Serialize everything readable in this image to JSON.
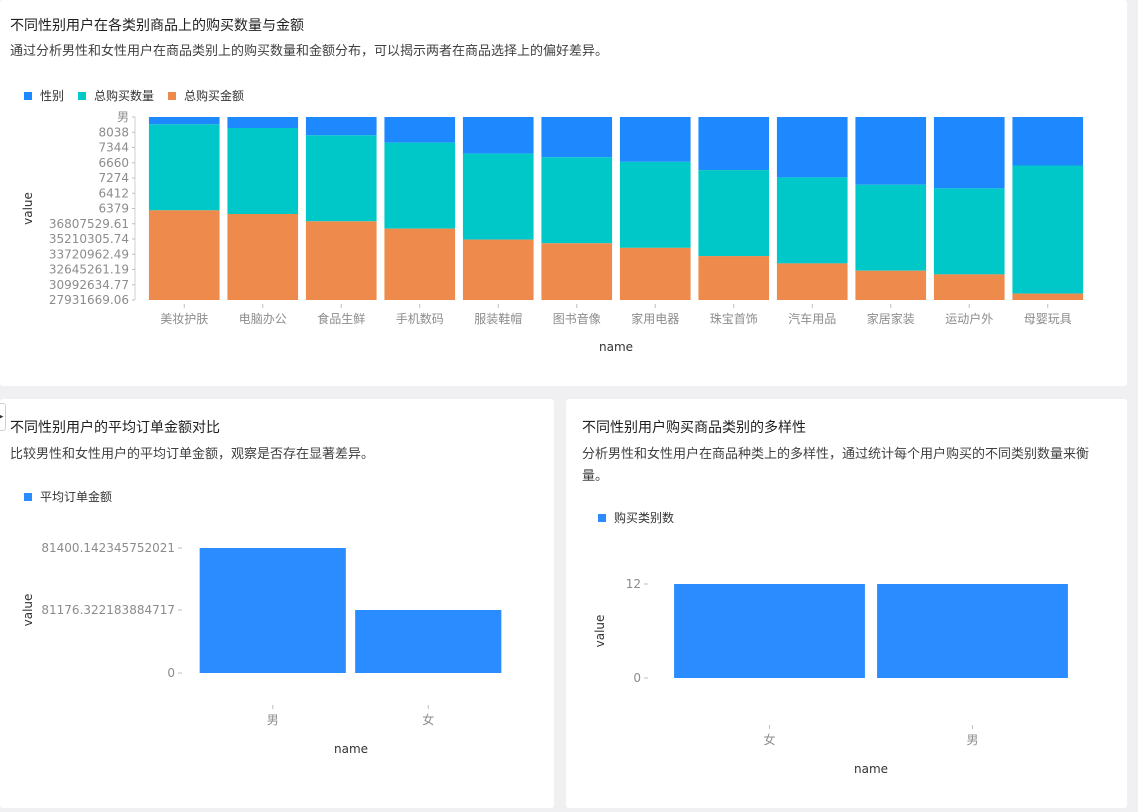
{
  "charts": [
    {
      "title": "不同性别用户在各类别商品上的购买数量与金额",
      "description": "通过分析男性和女性用户在商品类别上的购买数量和金额分布，可以揭示两者在商品选择上的偏好差异。"
    },
    {
      "title": "不同性别用户的平均订单金额对比",
      "description": "比较男性和女性用户的平均订单金额，观察是否存在显著差异。"
    },
    {
      "title": "不同性别用户购买商品类别的多样性",
      "description": "分析男性和女性用户在商品种类上的多样性，通过统计每个用户购买的不同类别数量来衡量。"
    }
  ],
  "chart_data": [
    {
      "type": "bar",
      "stacked": true,
      "percent_stacked": true,
      "xlabel": "name",
      "ylabel": "value",
      "categories": [
        "美妆护肤",
        "电脑办公",
        "食品生鲜",
        "手机数码",
        "服装鞋帽",
        "图书音像",
        "家用电器",
        "珠宝首饰",
        "汽车用品",
        "家居家装",
        "运动户外",
        "母婴玩具"
      ],
      "series": [
        {
          "name": "性别",
          "color": "#1e88ff",
          "values": [
            0.04,
            0.06,
            0.1,
            0.14,
            0.2,
            0.22,
            0.245,
            0.29,
            0.33,
            0.37,
            0.39,
            0.265
          ]
        },
        {
          "name": "总购买数量",
          "color": "#00c8c8",
          "values": [
            0.47,
            0.47,
            0.47,
            0.47,
            0.47,
            0.47,
            0.47,
            0.47,
            0.47,
            0.47,
            0.47,
            0.7
          ]
        },
        {
          "name": "总购买金额",
          "color": "#ee8a4c",
          "values": [
            0.49,
            0.47,
            0.43,
            0.39,
            0.33,
            0.31,
            0.285,
            0.24,
            0.2,
            0.16,
            0.14,
            0.035
          ]
        }
      ],
      "y_tick_labels": [
        "男",
        "8038",
        "7344",
        "6660",
        "7274",
        "6412",
        "6379",
        "36807529.61",
        "35210305.74",
        "33720962.49",
        "32645261.19",
        "30992634.77",
        "27931669.06"
      ],
      "legend_position": "top-left",
      "grid": false
    },
    {
      "type": "bar",
      "xlabel": "name",
      "ylabel": "value",
      "categories": [
        "男",
        "女"
      ],
      "series": [
        {
          "name": "平均订单金额",
          "color": "#2a8cff",
          "values": [
            81400.14234575201,
            81176.32218388472
          ]
        }
      ],
      "y_tick_labels": [
        "0",
        "81176.322183884717",
        "81400.142345752021"
      ],
      "legend_position": "top-left",
      "grid": false
    },
    {
      "type": "bar",
      "xlabel": "name",
      "ylabel": "value",
      "categories": [
        "女",
        "男"
      ],
      "series": [
        {
          "name": "购买类别数",
          "color": "#2a8cff",
          "values": [
            12,
            12
          ]
        }
      ],
      "y_tick_labels": [
        "0",
        "12"
      ],
      "ylim": [
        0,
        12
      ],
      "legend_position": "top-left",
      "grid": false
    }
  ]
}
